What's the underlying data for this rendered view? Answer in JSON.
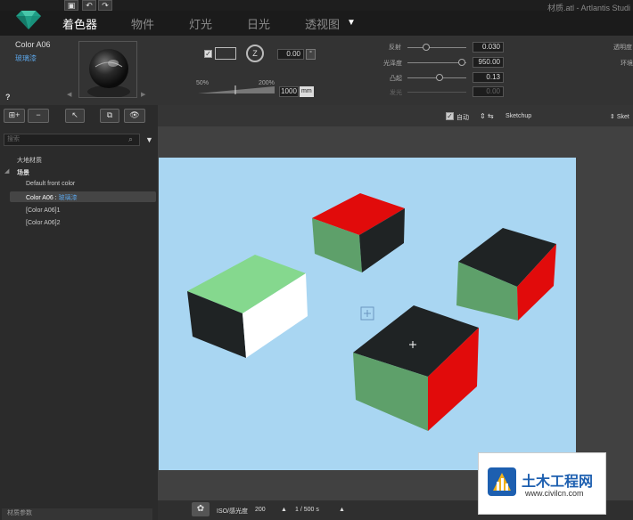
{
  "window": {
    "title": "材质.atl - Artlantis Studi"
  },
  "nav": {
    "tabs": [
      "着色器",
      "物件",
      "灯光",
      "日光",
      "透视图"
    ],
    "active_index": 0,
    "dropdown": "▼"
  },
  "material": {
    "name": "Color A06",
    "subtitle": "玻璃漆",
    "help": "?"
  },
  "props": {
    "opacity_value": "0.00",
    "opacity_unit": "°",
    "timer_label": "Z",
    "scale_min": "50%",
    "scale_max": "200%",
    "size_value": "1000",
    "size_unit": "mm",
    "reflection_label": "反射",
    "reflection_value": "0.030",
    "gloss_label": "光泽度",
    "gloss_value": "950.00",
    "bump_label": "凸起",
    "bump_value": "0.13",
    "emission_label": "发光",
    "emission_value": "0.00",
    "transparency_label": "透明度",
    "env_label": "环境"
  },
  "left": {
    "search_placeholder": "搜索",
    "tree": {
      "root": "大地材质",
      "scene": "场景",
      "items": [
        "Default front color",
        "Color A06 : ",
        "[Color A06]1",
        "[Color A06]2"
      ],
      "selected_suffix": "玻璃漆"
    },
    "footer": "材质参数"
  },
  "viewport": {
    "auto_label": "自动",
    "source_label": "Sketchup",
    "source_label_right": "Sket"
  },
  "status": {
    "iso_label": "ISO/感光度",
    "iso_value": "200",
    "shutter_value": "1 / 500 s"
  },
  "watermark": {
    "title": "土木工程网",
    "url": "www.civilcn.com"
  },
  "colors": {
    "sky": "#a9d6f2",
    "green_face": "#5ea06a",
    "light_green_face": "#85d88e",
    "red_face": "#e10b0b",
    "dark_face": "#1f2324",
    "white_face": "#ffffff",
    "accent_blue": "#5aa0e0"
  }
}
